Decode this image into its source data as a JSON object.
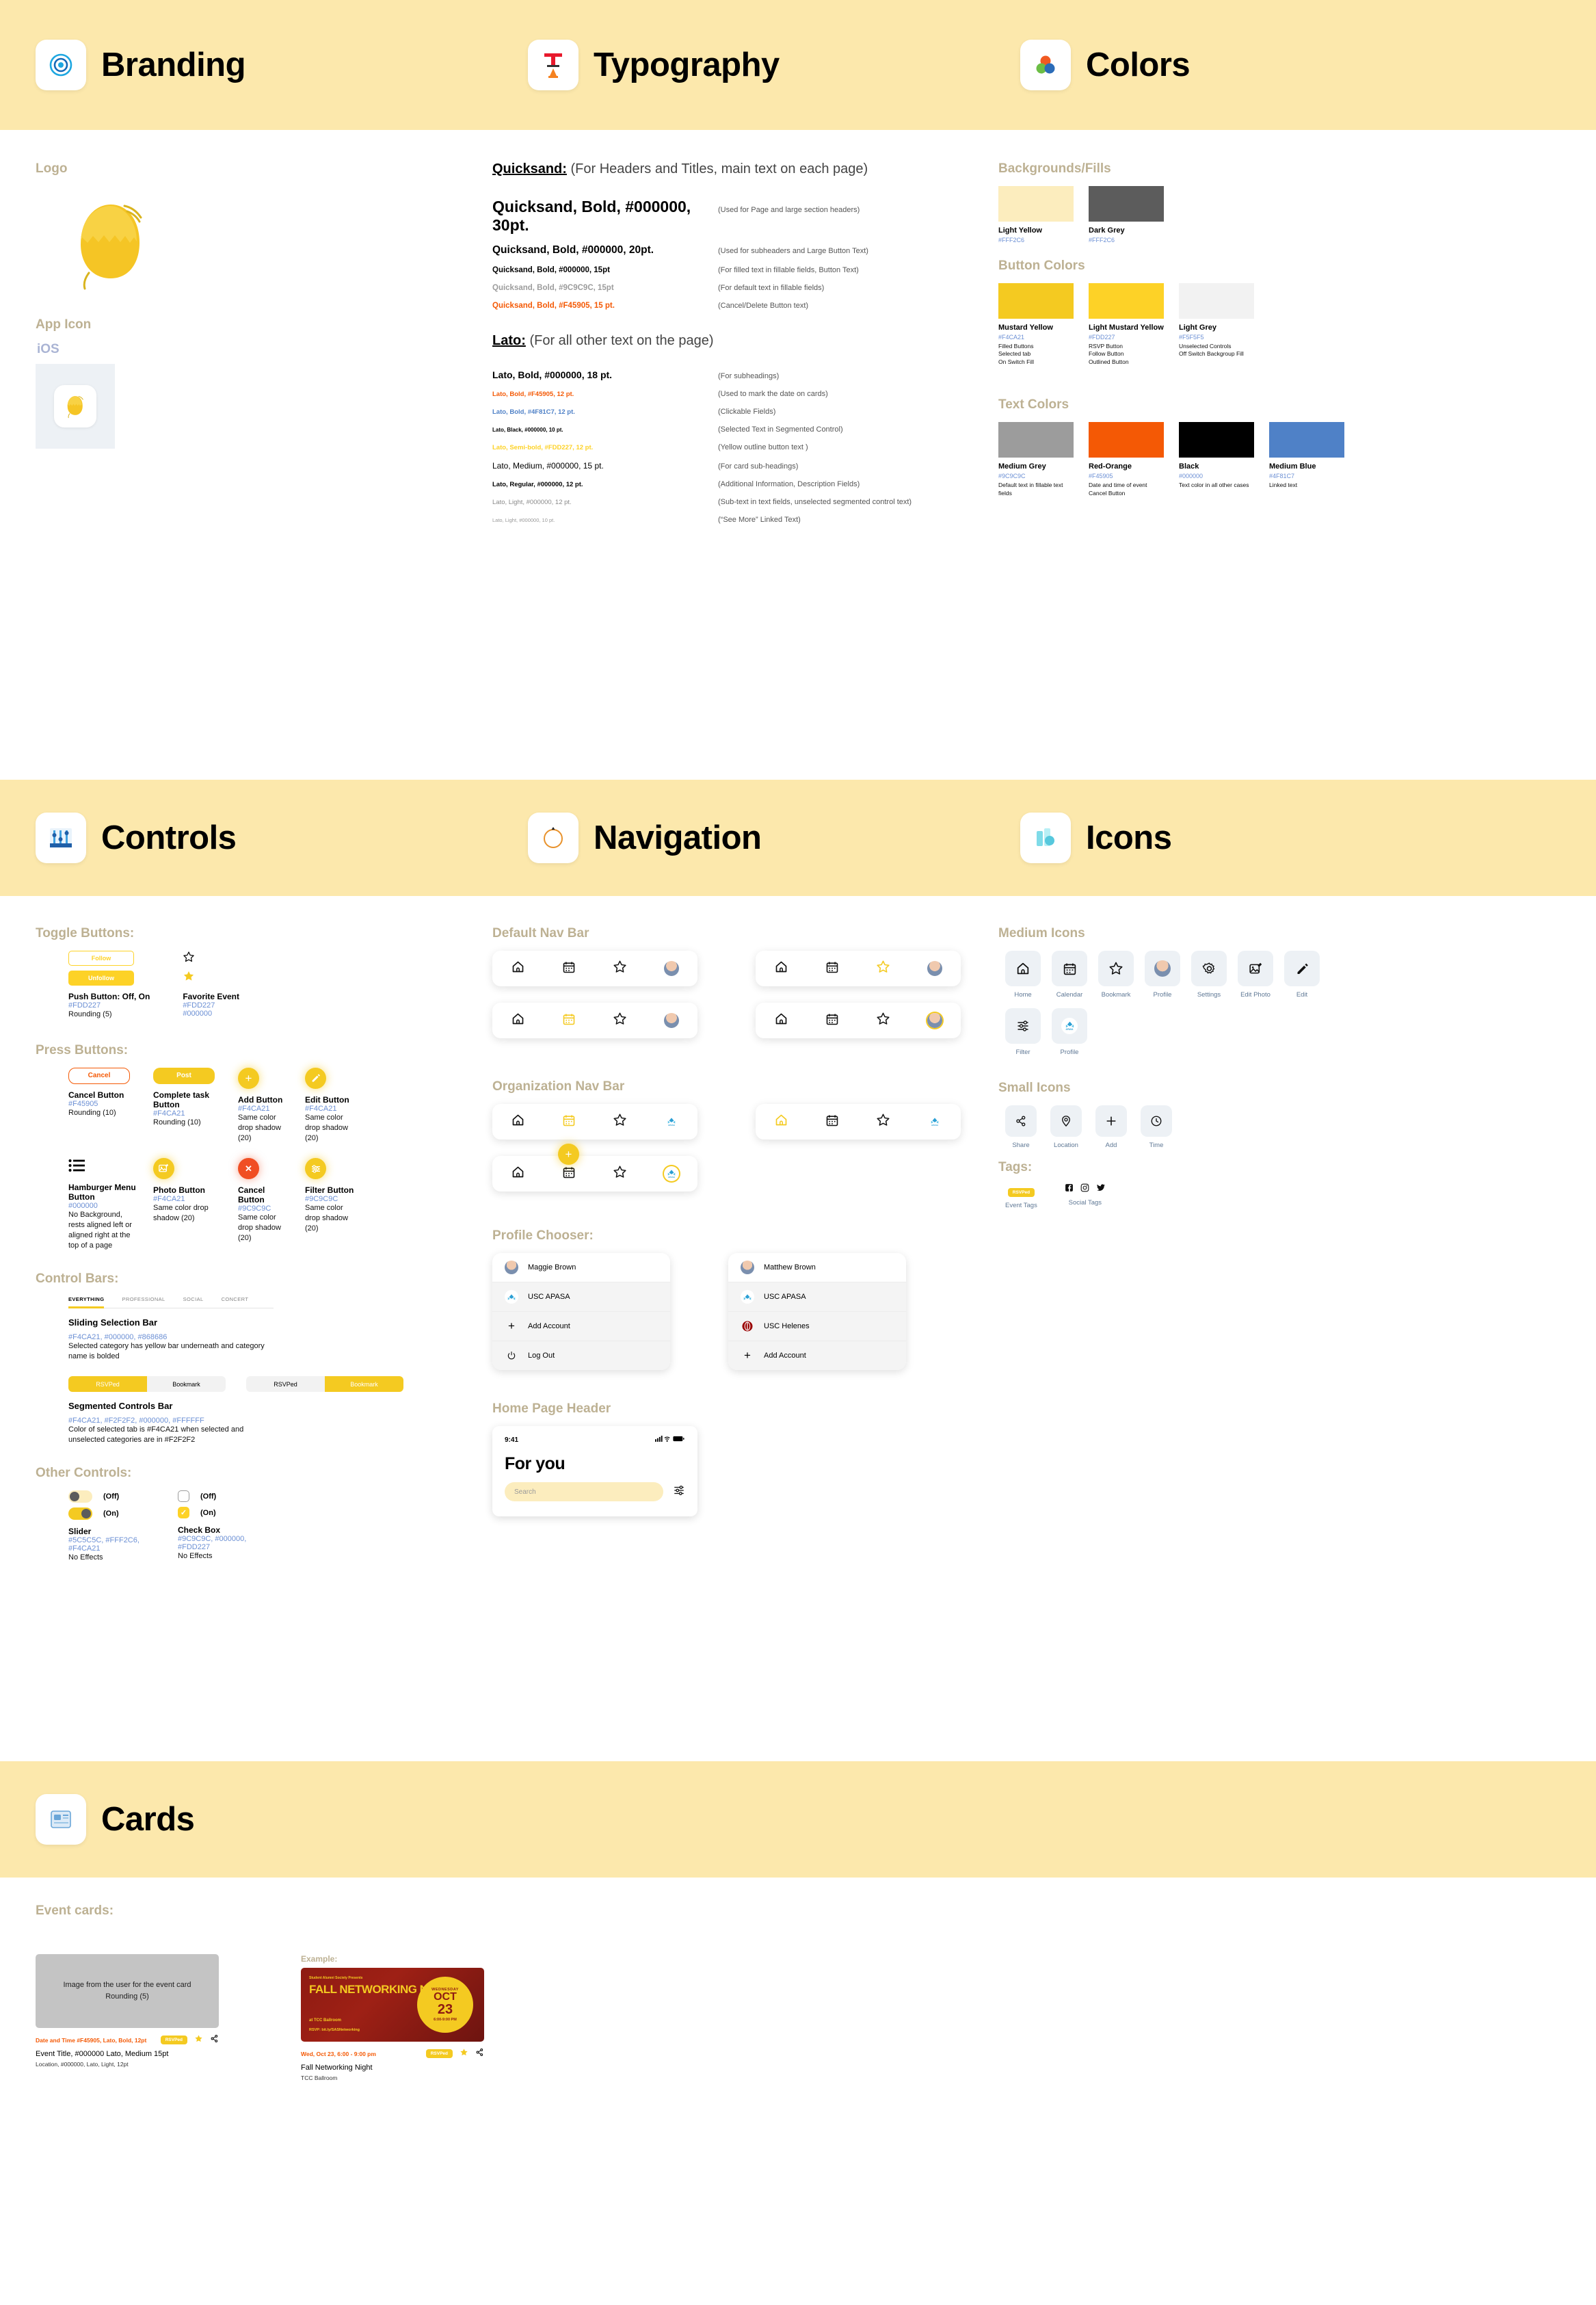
{
  "bands": {
    "first": [
      {
        "title": "Branding",
        "icon": "target-spiral-icon"
      },
      {
        "title": "Typography",
        "icon": "typography-t-icon"
      },
      {
        "title": "Colors",
        "icon": "color-circles-icon"
      }
    ],
    "second": [
      {
        "title": "Controls",
        "icon": "sliders-controls-icon"
      },
      {
        "title": "Navigation",
        "icon": "compass-icon"
      },
      {
        "title": "Icons",
        "icon": "layers-icons-icon"
      }
    ],
    "third": [
      {
        "title": "Cards",
        "icon": "card-stack-icon"
      }
    ]
  },
  "branding": {
    "logo_label": "Logo",
    "app_icon_label": "App Icon",
    "platform_label": "iOS"
  },
  "typography": {
    "quicksand": {
      "heading": "Quicksand:",
      "heading_note": "(For Headers and Titles, main text on each page)",
      "rows": [
        {
          "spec": "Quicksand, Bold, #000000, 30pt.",
          "use": "(Used for Page and large section headers)"
        },
        {
          "spec": "Quicksand, Bold, #000000, 20pt.",
          "use": "(Used for subheaders and Large Button Text)"
        },
        {
          "spec": "Quicksand, Bold, #000000, 15pt",
          "use": "(For filled text in fillable fields, Button Text)"
        },
        {
          "spec": "Quicksand, Bold, #9C9C9C, 15pt",
          "use": "(For default text in fillable fields)"
        },
        {
          "spec": "Quicksand, Bold, #F45905, 15 pt.",
          "use": "(Cancel/Delete Button text)"
        }
      ]
    },
    "lato": {
      "heading": "Lato:",
      "heading_note": "(For all other text on the page)",
      "rows": [
        {
          "spec": "Lato, Bold, #000000, 18 pt.",
          "use": "(For subheadings)"
        },
        {
          "spec": "Lato, Bold, #F45905, 12 pt.",
          "use": "(Used to mark the date on cards)"
        },
        {
          "spec": "Lato, Bold, #4F81C7, 12 pt.",
          "use": "(Clickable Fields)"
        },
        {
          "spec": "Lato, Black, #000000, 10 pt.",
          "use": "(Selected Text in Segmented Control)"
        },
        {
          "spec": "Lato, Semi-bold, #FDD227, 12 pt.",
          "use": "(Yellow outline button text )"
        },
        {
          "spec": "Lato, Medium, #000000, 15 pt.",
          "use": "(For card sub-headings)"
        },
        {
          "spec": "Lato, Regular, #000000, 12 pt.",
          "use": "(Additional Information, Description Fields)"
        },
        {
          "spec": "Lato, Light, #000000, 12 pt.",
          "use": "(Sub-text in text fields, unselected segmented control text)"
        },
        {
          "spec": "Lato, Light, #000000, 10 pt.",
          "use": "(“See More” Linked Text)"
        }
      ]
    }
  },
  "colors": {
    "backgrounds_label": "Backgrounds/Fills",
    "backgrounds": [
      {
        "name": "Light Yellow",
        "hex_label": "#FFF2C6",
        "swatch": "#FCEDBE",
        "use": ""
      },
      {
        "name": "Dark Grey",
        "hex_label": "#FFF2C6",
        "swatch": "#5C5C5C",
        "use": ""
      }
    ],
    "button_label": "Button Colors",
    "buttons": [
      {
        "name": "Mustard Yellow",
        "hex_label": "#F4CA21",
        "swatch": "#F4CA21",
        "use": "Filled Buttons\nSelected tab\nOn Switch Fill"
      },
      {
        "name": "Light Mustard Yellow",
        "hex_label": "#FDD227",
        "swatch": "#FDD227",
        "use": "RSVP Button\nFollow Button\nOutlined Button"
      },
      {
        "name": "Light Grey",
        "hex_label": "#F5F5F5",
        "swatch": "#F2F2F2",
        "use": "Unselected Controls\nOff Switch Backgroup Fill"
      }
    ],
    "text_label": "Text Colors",
    "texts": [
      {
        "name": "Medium Grey",
        "hex_label": "#9C9C9C",
        "swatch": "#9C9C9C",
        "use": "Default text in fillable text fields"
      },
      {
        "name": "Red-Orange",
        "hex_label": "#F45905",
        "swatch": "#F45905",
        "use": "Date and time of event\nCancel Button"
      },
      {
        "name": "Black",
        "hex_label": "#000000",
        "swatch": "#000000",
        "use": "Text color in all other cases"
      },
      {
        "name": "Medium Blue",
        "hex_label": "#4F81C7",
        "swatch": "#4F81C7",
        "use": "Linked text"
      }
    ]
  },
  "controls": {
    "toggle_label": "Toggle Buttons:",
    "toggle": {
      "follow": "Follow",
      "unfollow": "Unfollow",
      "push_name": "Push Button: Off, On",
      "push_hex": "#FDD227",
      "push_note": "Rounding (5)",
      "fav_name": "Favorite Event",
      "fav_hex1": "#FDD227",
      "fav_hex2": "#000000"
    },
    "press_label": "Press Buttons:",
    "press": [
      {
        "label": "Cancel",
        "name": "Cancel Button",
        "hex": "#F45905",
        "note": "Rounding (10)"
      },
      {
        "label": "Post",
        "name": "Complete task Button",
        "hex": "#F4CA21",
        "note": "Rounding (10)"
      },
      {
        "label": "+",
        "name": "Add Button",
        "hex": "#F4CA21",
        "note": "Same color drop shadow (20)"
      },
      {
        "label": "✎",
        "name": "Edit Button",
        "hex": "#F4CA21",
        "note": "Same color drop shadow (20)"
      }
    ],
    "press2": [
      {
        "name": "Hamburger Menu Button",
        "hex": "#000000",
        "note": "No Background, rests aligned left or aligned right at the top of a page"
      },
      {
        "name": "Photo Button",
        "hex": "#F4CA21",
        "note": "Same color drop shadow (20)"
      },
      {
        "name": "Cancel Button",
        "hex": "#9C9C9C",
        "note": "Same color drop shadow (20)"
      },
      {
        "name": "Filter Button",
        "hex": "#9C9C9C",
        "note": "Same color drop shadow (20)"
      }
    ],
    "bars_label": "Control Bars:",
    "sliding": {
      "tabs": [
        "EVERYTHING",
        "PROFESSIONAL",
        "SOCIAL",
        "CONCERT"
      ],
      "selected": "EVERYTHING",
      "name": "Sliding Selection Bar",
      "hex": "#F4CA21, #000000, #868686",
      "note": "Selected category has yellow bar underneath and category name is bolded"
    },
    "segmented": {
      "left": {
        "a": "RSVPed",
        "b": "Bookmark",
        "selected": "RSVPed"
      },
      "right": {
        "a": "RSVPed",
        "b": "Bookmark",
        "selected": "Bookmark"
      },
      "name": "Segmented Controls Bar",
      "hex": "#F4CA21, #F2F2F2, #000000, #FFFFFF",
      "note": "Color of selected tab is #F4CA21 when selected and unselected categories are in #F2F2F2"
    },
    "other_label": "Other Controls:",
    "slider": {
      "off": "(Off)",
      "on": "(On)",
      "name": "Slider",
      "hex": "#5C5C5C, #FFF2C6, #F4CA21",
      "note": "No Effects"
    },
    "checkbox": {
      "off": "(Off)",
      "on": "(On)",
      "name": "Check Box",
      "hex": "#9C9C9C, #000000, #FDD227",
      "note": "No Effects"
    }
  },
  "navigation": {
    "default_label": "Default Nav Bar",
    "org_label": "Organization Nav Bar",
    "profile_label": "Profile Chooser:",
    "header_label": "Home Page Header",
    "profile_chooser_left": [
      {
        "label": "Maggie  Brown",
        "icon": "avatar-icon"
      },
      {
        "label": "USC APASA",
        "icon": "apasa-logo-icon"
      },
      {
        "label": "Add Account",
        "icon": "plus-icon"
      },
      {
        "label": "Log Out",
        "icon": "power-icon"
      }
    ],
    "profile_chooser_right": [
      {
        "label": "Matthew Brown",
        "icon": "avatar-icon"
      },
      {
        "label": "USC APASA",
        "icon": "apasa-logo-icon"
      },
      {
        "label": "USC Helenes",
        "icon": "helenes-logo-icon"
      },
      {
        "label": "Add Account",
        "icon": "plus-icon"
      }
    ],
    "phone": {
      "time": "9:41",
      "title": "For you",
      "search_placeholder": "Search"
    }
  },
  "icons": {
    "medium_label": "Medium Icons",
    "small_label": "Small Icons",
    "tags_label": "Tags:",
    "medium": [
      {
        "label": "Home",
        "icon": "home-icon"
      },
      {
        "label": "Calendar",
        "icon": "calendar-icon"
      },
      {
        "label": "Bookmark",
        "icon": "star-icon"
      },
      {
        "label": "Profile",
        "icon": "avatar-icon"
      },
      {
        "label": "Settings",
        "icon": "gear-icon"
      },
      {
        "label": "Edit Photo",
        "icon": "edit-photo-icon"
      },
      {
        "label": "Edit",
        "icon": "pencil-icon"
      },
      {
        "label": "Filter",
        "icon": "filter-icon"
      },
      {
        "label": "Profile",
        "icon": "apasa-logo-icon"
      }
    ],
    "small": [
      {
        "label": "Share",
        "icon": "share-icon"
      },
      {
        "label": "Location",
        "icon": "location-pin-icon"
      },
      {
        "label": "Add",
        "icon": "plus-icon"
      },
      {
        "label": "Time",
        "icon": "clock-icon"
      }
    ],
    "tags": [
      {
        "label": "Event Tags",
        "pill": "RSVPed"
      },
      {
        "label": "Social Tags",
        "pill": ""
      }
    ]
  },
  "cards": {
    "event_label": "Event cards:",
    "example_label": "Example:",
    "template": {
      "image_note": "Image from the user for the event card\nRounding (5)",
      "date": "Date and Time #F45905, Lato, Bold, 12pt",
      "title": "Event Title, #000000 Lato, Medium 15pt",
      "location": "Location, #000000, Lato, Light, 12pt",
      "tag": "RSVPed"
    },
    "example": {
      "poster_presents": "Student Alumni Society Presents",
      "poster_title": "FALL NETWORKING NIGHT",
      "poster_at": "at TCC Ballroom",
      "poster_rsvp": "RSVP: bit.ly/SASNetworking",
      "poster_dow": "WEDNESDAY",
      "poster_month": "OCT",
      "poster_day": "23",
      "poster_time": "6:00-9:00 PM",
      "date": "Wed, Oct 23, 6:00 - 9:00 pm",
      "title": "Fall Networking Night",
      "location": "TCC Ballroom",
      "tag": "RSVPed"
    }
  }
}
